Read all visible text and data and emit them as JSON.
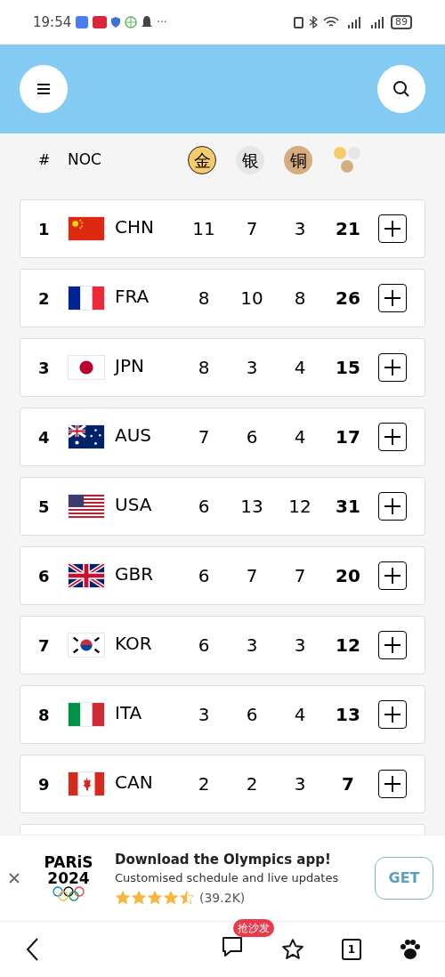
{
  "status_bar": {
    "time": "19:54",
    "more": "···",
    "battery": "89"
  },
  "header_columns": {
    "rank": "#",
    "noc": "NOC",
    "gold": "金",
    "silver": "银",
    "bronze": "铜"
  },
  "rows": [
    {
      "rank": "1",
      "noc": "CHN",
      "kind": "chn",
      "gold": "11",
      "silver": "7",
      "bronze": "3",
      "total": "21"
    },
    {
      "rank": "2",
      "noc": "FRA",
      "kind": "fra",
      "gold": "8",
      "silver": "10",
      "bronze": "8",
      "total": "26"
    },
    {
      "rank": "3",
      "noc": "JPN",
      "kind": "jpn",
      "gold": "8",
      "silver": "3",
      "bronze": "4",
      "total": "15"
    },
    {
      "rank": "4",
      "noc": "AUS",
      "kind": "aus",
      "gold": "7",
      "silver": "6",
      "bronze": "4",
      "total": "17"
    },
    {
      "rank": "5",
      "noc": "USA",
      "kind": "usa",
      "gold": "6",
      "silver": "13",
      "bronze": "12",
      "total": "31"
    },
    {
      "rank": "6",
      "noc": "GBR",
      "kind": "gbr",
      "gold": "6",
      "silver": "7",
      "bronze": "7",
      "total": "20"
    },
    {
      "rank": "7",
      "noc": "KOR",
      "kind": "kor",
      "gold": "6",
      "silver": "3",
      "bronze": "3",
      "total": "12"
    },
    {
      "rank": "8",
      "noc": "ITA",
      "kind": "ita",
      "gold": "3",
      "silver": "6",
      "bronze": "4",
      "total": "13"
    },
    {
      "rank": "9",
      "noc": "CAN",
      "kind": "can",
      "gold": "2",
      "silver": "2",
      "bronze": "3",
      "total": "7"
    }
  ],
  "ad": {
    "logo_line_1": "PARiS",
    "logo_line_2": "2024",
    "title": "Download the Olympics app!",
    "subtitle": "Customised schedule and live updates",
    "stars": 4.5,
    "rating_count": "(39.2K)",
    "button": "GET"
  },
  "bottom_nav": {
    "comment_badge": "抢沙发",
    "tab_count": "1"
  }
}
